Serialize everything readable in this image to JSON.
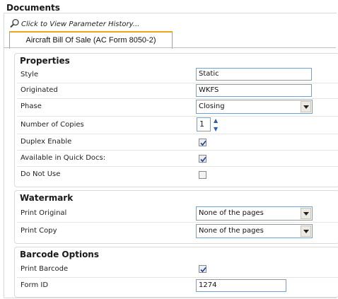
{
  "page_title": "Documents",
  "history_link": "Click to View Parameter History...",
  "tab_label": "Aircraft Bill Of Sale (AC Form 8050-2)",
  "properties": {
    "title": "Properties",
    "style_label": "Style",
    "style_value": "Static",
    "originated_label": "Originated",
    "originated_value": "WKFS",
    "phase_label": "Phase",
    "phase_value": "Closing",
    "copies_label": "Number of Copies",
    "copies_value": "1",
    "duplex_label": "Duplex Enable",
    "duplex_checked": true,
    "quickdocs_label": "Available in Quick Docs:",
    "quickdocs_checked": true,
    "donotuse_label": "Do Not Use",
    "donotuse_checked": false
  },
  "watermark": {
    "title": "Watermark",
    "print_original_label": "Print Original",
    "print_original_value": "None of the pages",
    "print_copy_label": "Print Copy",
    "print_copy_value": "None of the pages"
  },
  "barcode": {
    "title": "Barcode Options",
    "print_barcode_label": "Print Barcode",
    "print_barcode_checked": true,
    "form_id_label": "Form ID",
    "form_id_value": "1274"
  }
}
